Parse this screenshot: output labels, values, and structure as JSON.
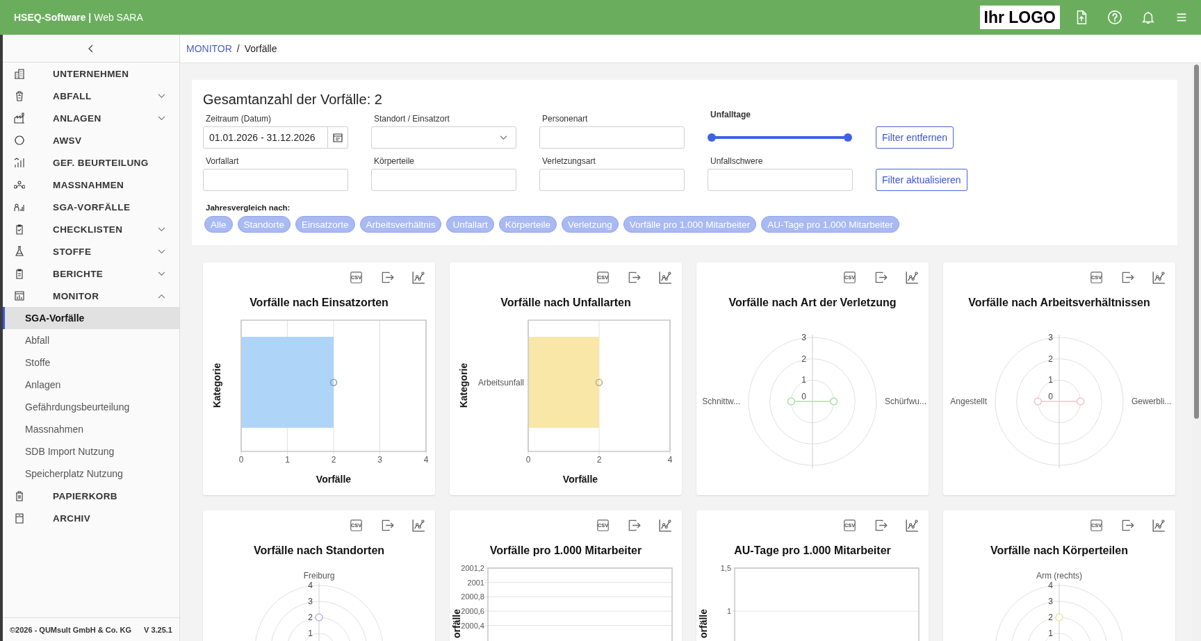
{
  "header": {
    "brand": "**HSEQ-Software |** Web SARA",
    "logo": "Ihr LOGO"
  },
  "sidebar": {
    "items": [
      {
        "label": "UNTERNEHMEN",
        "kind": "link"
      },
      {
        "label": "ABFALL",
        "kind": "group",
        "expanded": false
      },
      {
        "label": "ANLAGEN",
        "kind": "group",
        "expanded": false
      },
      {
        "label": "AWSV",
        "kind": "link"
      },
      {
        "label": "GEF. BEURTEILUNG",
        "kind": "link"
      },
      {
        "label": "MASSNAHMEN",
        "kind": "link"
      },
      {
        "label": "SGA-VORFÄLLE",
        "kind": "link"
      },
      {
        "label": "CHECKLISTEN",
        "kind": "group",
        "expanded": false
      },
      {
        "label": "STOFFE",
        "kind": "group",
        "expanded": false
      },
      {
        "label": "BERICHTE",
        "kind": "group",
        "expanded": false
      },
      {
        "label": "MONITOR",
        "kind": "group",
        "expanded": true,
        "children": [
          {
            "label": "SGA-Vorfälle",
            "selected": true
          },
          {
            "label": "Abfall",
            "selected": false
          },
          {
            "label": "Stoffe",
            "selected": false
          },
          {
            "label": "Anlagen",
            "selected": false
          },
          {
            "label": "Gefährdungsbeurteilung",
            "selected": false
          },
          {
            "label": "Massnahmen",
            "selected": false
          },
          {
            "label": "SDB Import Nutzung",
            "selected": false
          },
          {
            "label": "Speicherplatz Nutzung",
            "selected": false
          }
        ]
      },
      {
        "label": "PAPIERKORB",
        "kind": "link"
      },
      {
        "label": "ARCHIV",
        "kind": "link"
      }
    ],
    "footer": "©2026 - QUMsult GmbH & Co. KG",
    "version": "V 3.25.1"
  },
  "breadcrumb": {
    "parent": "MONITOR",
    "separator": "/",
    "current": "Vorfälle"
  },
  "filters": {
    "total": "Gesamtanzahl der Vorfälle: 2",
    "fields": [
      {
        "label": "Zeitraum (Datum)",
        "kind": "date",
        "value": "01.01.2026 - 31.12.2026"
      },
      {
        "label": "Standort / Einsatzort",
        "kind": "select"
      },
      {
        "label": "Personenart",
        "kind": "text"
      },
      {
        "label": "Unfalltage",
        "kind": "range",
        "thumbs": [
          {
            "level": 0
          },
          {
            "level": 1
          }
        ]
      },
      {
        "label": "Vorfallart",
        "kind": "text"
      },
      {
        "label": "Körperteile",
        "kind": "text"
      },
      {
        "label": "Verletzungsart",
        "kind": "text"
      },
      {
        "label": "Unfallschwere",
        "kind": "text"
      }
    ],
    "buttons": [
      "Filter entfernen",
      "Filter aktualisieren"
    ],
    "comparison_label": "Jahresvergleich nach:",
    "comparison_chips": [
      "Alle",
      "Standorte",
      "Einsatzorte",
      "Arbeitsverhältnis",
      "Unfallart",
      "Körperteile",
      "Verletzung",
      "Vorfälle pro 1.000 Mitarbeiter",
      "AU-Tage pro 1.000 Mitarbeiter"
    ]
  },
  "charts": [
    {
      "title": "Vorfälle nach Einsatzorten",
      "csv": "CSV",
      "kind": "bar",
      "chart_data": {
        "type": "bar",
        "orientation": "horizontal",
        "xlabel": "Vorfälle",
        "ylabel": "Kategorie",
        "series": [
          {
            "color": "#aed4f8",
            "values": [
              2
            ]
          }
        ],
        "xlim": [
          0,
          4
        ],
        "xticks": [
          {
            "value": 0,
            "label": "0"
          },
          {
            "value": 1,
            "label": "1"
          },
          {
            "value": 2,
            "label": "2"
          },
          {
            "value": 3,
            "label": "3"
          },
          {
            "value": 4,
            "label": "4"
          }
        ],
        "grid": true
      }
    },
    {
      "title": "Vorfälle nach Unfallarten",
      "csv": "CSV",
      "kind": "bar",
      "chart_data": {
        "type": "bar",
        "orientation": "horizontal",
        "xlabel": "Vorfälle",
        "ylabel": "Kategorie",
        "categories": [
          "Arbeitsunfall"
        ],
        "series": [
          {
            "color": "#f9e7a7",
            "values": [
              2
            ]
          }
        ],
        "xlim": [
          0,
          4
        ],
        "xticks": [
          {
            "value": 0,
            "label": "0"
          },
          {
            "value": 2,
            "label": "2"
          },
          {
            "value": 4,
            "label": "4"
          }
        ],
        "grid": true
      }
    },
    {
      "title": "Vorfälle nach Art der Verletzung",
      "csv": "CSV",
      "kind": "radar",
      "radar": {
        "axis_labels": [
          "Schnittw...",
          "Schürfwu..."
        ],
        "tick_labels": [
          "3",
          "2",
          "1",
          "0"
        ],
        "color": "#a6e3a6"
      }
    },
    {
      "title": "Vorfälle nach Arbeitsverhältnissen",
      "csv": "CSV",
      "kind": "radar",
      "radar": {
        "axis_labels": [
          "Angestellt",
          "Gewerbli..."
        ],
        "tick_labels": [
          "3",
          "2",
          "1",
          "0"
        ],
        "color": "#f4c1cc"
      }
    },
    {
      "title": "Vorfälle nach Standorten",
      "csv": "CSV",
      "kind": "radar",
      "radar": {
        "axis_labels": [
          "Freiburg"
        ],
        "tick_labels": [
          "4",
          "3",
          "2",
          "1"
        ],
        "color": "#b9b9e3"
      }
    },
    {
      "title": "Vorfälle pro 1.000 Mitarbeiter",
      "csv": "CSV",
      "kind": "bar",
      "chart_data": {
        "type": "bar",
        "orientation": "vertical",
        "series": [
          {
            "values": [
              null
            ]
          }
        ],
        "ylabel": "orfälle",
        "ylim": [
          1999.4,
          2001.2
        ],
        "yticks": [
          {
            "value": 2001.2,
            "label": "2001,2"
          },
          {
            "value": 2001,
            "label": "2001"
          },
          {
            "value": 2000.8,
            "label": "2000,8"
          },
          {
            "value": 2000.6,
            "label": "2000,6"
          },
          {
            "value": 2000.4,
            "label": "2000,4"
          }
        ],
        "grid": true
      }
    },
    {
      "title": "AU-Tage pro 1.000 Mitarbeiter",
      "csv": "CSV",
      "kind": "bar",
      "chart_data": {
        "type": "bar",
        "orientation": "vertical",
        "series": [
          {
            "values": [
              null
            ]
          }
        ],
        "ylabel": "orfälle",
        "ylim": [
          0,
          1.5
        ],
        "yticks": [
          {
            "value": 1.5,
            "label": "1,5"
          },
          {
            "value": 1,
            "label": "1"
          }
        ],
        "grid": true
      }
    },
    {
      "title": "Vorfälle nach Körperteilen",
      "csv": "CSV",
      "kind": "radar",
      "radar": {
        "axis_labels": [
          "Arm (rechts)"
        ],
        "tick_labels": [
          "4",
          "3",
          "2",
          "1"
        ],
        "color": "#f2e69a"
      }
    }
  ]
}
